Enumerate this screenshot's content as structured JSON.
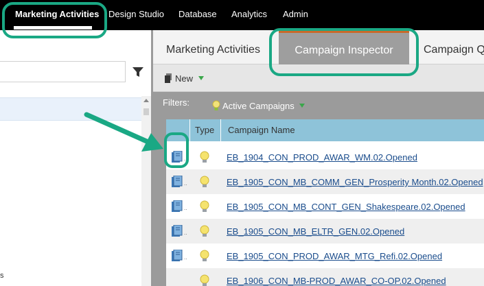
{
  "top_nav": {
    "items": [
      {
        "label": "Marketing Activities",
        "active": true
      },
      {
        "label": "Design Studio"
      },
      {
        "label": "Database"
      },
      {
        "label": "Analytics"
      },
      {
        "label": "Admin"
      }
    ]
  },
  "left_panel": {
    "search_placeholder": "",
    "bottom_fragment": "s"
  },
  "tabs": [
    {
      "label": "Marketing Activities"
    },
    {
      "label": "Campaign Inspector",
      "active": true
    },
    {
      "label": "Campaign Q"
    }
  ],
  "toolbar": {
    "new_label": "New"
  },
  "filters": {
    "label": "Filters:",
    "active_filter": "Active Campaigns"
  },
  "grid": {
    "columns": {
      "type": "Type",
      "name": "Campaign Name"
    },
    "rows": [
      {
        "name": "EB_1904_CON_PROD_AWAR_WM.02.Opened"
      },
      {
        "name": "EB_1905_CON_MB_COMM_GEN_Prosperity Month.02.Opened"
      },
      {
        "name": "EB_1905_CON_MB_CONT_GEN_Shakespeare.02.Opened"
      },
      {
        "name": "EB_1905_CON_MB_ELTR_GEN.02.Opened"
      },
      {
        "name": "EB_1905_CON_PROD_AWAR_MTG_Refi.02.Opened"
      },
      {
        "name": "EB_1906_CON_MB-PROD_AWAR_CO-OP.02.Opened"
      }
    ]
  },
  "colors": {
    "callout": "#1aa884",
    "nav_bg": "#000000",
    "active_tab": "#9e9e9e",
    "grid_header": "#8ec3d9",
    "link": "#1a4c8c"
  },
  "icons": {
    "filter": "funnel-icon",
    "new": "document-stack-icon",
    "campaign_type": "lightbulb-icon",
    "row_select": "campaign-book-icon"
  }
}
